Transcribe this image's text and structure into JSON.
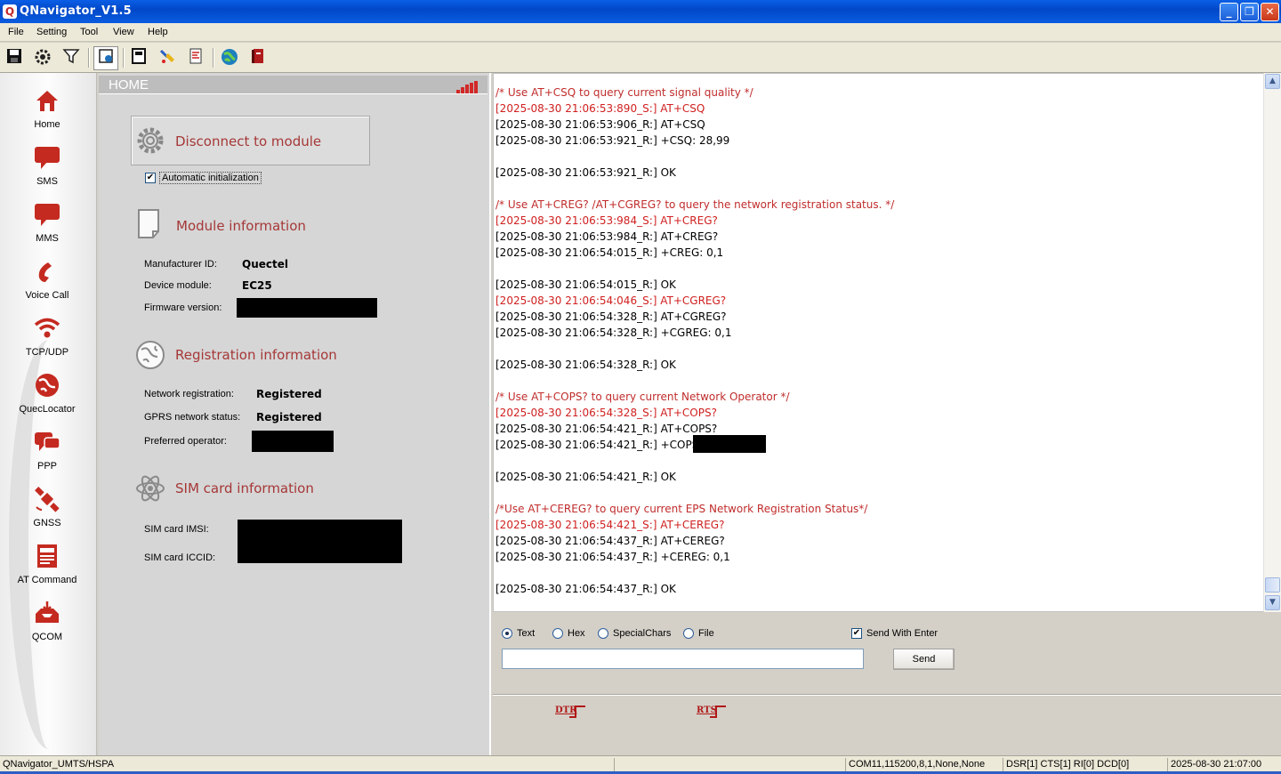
{
  "window": {
    "title": "QNavigator_V1.5",
    "app_icon": "Q"
  },
  "menu": [
    "File",
    "Setting",
    "Tool",
    "View",
    "Help"
  ],
  "toolbar_icons": [
    "save-icon",
    "settings-icon",
    "filter-icon",
    "home-icon",
    "save-as-icon",
    "clear-icon",
    "script-icon",
    "globe-icon",
    "book-icon"
  ],
  "nav": [
    {
      "label": "Home",
      "icon": "house-icon"
    },
    {
      "label": "SMS",
      "icon": "speech-bubble-icon"
    },
    {
      "label": "MMS",
      "icon": "speech-bubble-icon"
    },
    {
      "label": "Voice Call",
      "icon": "phone-icon"
    },
    {
      "label": "TCP/UDP",
      "icon": "wifi-icon"
    },
    {
      "label": "QuecLocator",
      "icon": "globe-icon"
    },
    {
      "label": "PPP",
      "icon": "chat-icon"
    },
    {
      "label": "GNSS",
      "icon": "satellite-icon"
    },
    {
      "label": "AT Command",
      "icon": "terminal-icon"
    },
    {
      "label": "QCOM",
      "icon": "inbox-icon"
    }
  ],
  "home": {
    "header": "HOME",
    "disconnect_label": "Disconnect to module",
    "auto_init_label": "Automatic initialization",
    "auto_init_checked": true,
    "module_info": {
      "title": "Module information",
      "manufacturer_label": "Manufacturer ID:",
      "manufacturer_value": "Quectel",
      "device_label": "Device module:",
      "device_value": "EC25",
      "firmware_label": "Firmware version:"
    },
    "registration_info": {
      "title": "Registration information",
      "network_label": "Network registration:",
      "network_value": "Registered",
      "gprs_label": "GPRS network status:",
      "gprs_value": "Registered",
      "operator_label": "Preferred operator:"
    },
    "sim_info": {
      "title": "SIM card information",
      "imsi_label": "SIM card IMSI:",
      "iccid_label": "SIM card ICCID:"
    }
  },
  "log": [
    {
      "type": "comment",
      "text": "/* Use AT+CSQ to query current signal quality */"
    },
    {
      "type": "sent",
      "text": "[2025-08-30 21:06:53:890_S:] AT+CSQ"
    },
    {
      "type": "recv",
      "text": "[2025-08-30 21:06:53:906_R:] AT+CSQ"
    },
    {
      "type": "recv",
      "text": "[2025-08-30 21:06:53:921_R:] +CSQ: 28,99"
    },
    {
      "type": "recv",
      "text": ""
    },
    {
      "type": "recv",
      "text": "[2025-08-30 21:06:53:921_R:] OK"
    },
    {
      "type": "recv",
      "text": ""
    },
    {
      "type": "comment",
      "text": "/* Use AT+CREG? /AT+CGREG? to query the network registration status. */"
    },
    {
      "type": "sent",
      "text": "[2025-08-30 21:06:53:984_S:] AT+CREG?"
    },
    {
      "type": "recv",
      "text": "[2025-08-30 21:06:53:984_R:] AT+CREG?"
    },
    {
      "type": "recv",
      "text": "[2025-08-30 21:06:54:015_R:] +CREG: 0,1"
    },
    {
      "type": "recv",
      "text": ""
    },
    {
      "type": "recv",
      "text": "[2025-08-30 21:06:54:015_R:] OK"
    },
    {
      "type": "sent",
      "text": "[2025-08-30 21:06:54:046_S:] AT+CGREG?"
    },
    {
      "type": "recv",
      "text": "[2025-08-30 21:06:54:328_R:] AT+CGREG?"
    },
    {
      "type": "recv",
      "text": "[2025-08-30 21:06:54:328_R:] +CGREG: 0,1"
    },
    {
      "type": "recv",
      "text": ""
    },
    {
      "type": "recv",
      "text": "[2025-08-30 21:06:54:328_R:] OK"
    },
    {
      "type": "recv",
      "text": ""
    },
    {
      "type": "comment",
      "text": "/* Use AT+COPS? to query current Network Operator */"
    },
    {
      "type": "sent",
      "text": "[2025-08-30 21:06:54:328_S:] AT+COPS?"
    },
    {
      "type": "recv",
      "text": "[2025-08-30 21:06:54:421_R:] AT+COPS?"
    },
    {
      "type": "recv",
      "text": "[2025-08-30 21:06:54:421_R:] +COPS:"
    },
    {
      "type": "recv",
      "text": ""
    },
    {
      "type": "recv",
      "text": "[2025-08-30 21:06:54:421_R:] OK"
    },
    {
      "type": "recv",
      "text": ""
    },
    {
      "type": "comment",
      "text": "/*Use AT+CEREG? to query current EPS Network Registration Status*/"
    },
    {
      "type": "sent",
      "text": "[2025-08-30 21:06:54:421_S:] AT+CEREG?"
    },
    {
      "type": "recv",
      "text": "[2025-08-30 21:06:54:437_R:] AT+CEREG?"
    },
    {
      "type": "recv",
      "text": "[2025-08-30 21:06:54:437_R:] +CEREG: 0,1"
    },
    {
      "type": "recv",
      "text": ""
    },
    {
      "type": "recv",
      "text": "[2025-08-30 21:06:54:437_R:] OK"
    }
  ],
  "send": {
    "mode_text": "Text",
    "mode_hex": "Hex",
    "mode_special": "SpecialChars",
    "mode_file": "File",
    "selected_mode": "Text",
    "send_with_enter_label": "Send With Enter",
    "send_with_enter_checked": true,
    "input_value": "",
    "send_label": "Send",
    "dtr_label": "DTR",
    "rts_label": "RTS"
  },
  "status": {
    "app": "QNavigator_UMTS/HSPA",
    "port": "COM11,115200,8,1,None,None",
    "signals": "DSR[1] CTS[1] RI[0] DCD[0]",
    "datetime": "2025-08-30 21:07:00"
  },
  "colors": {
    "accent_red": "#a63737",
    "log_red": "#c12c2c",
    "title_blue": "#0148c8"
  }
}
